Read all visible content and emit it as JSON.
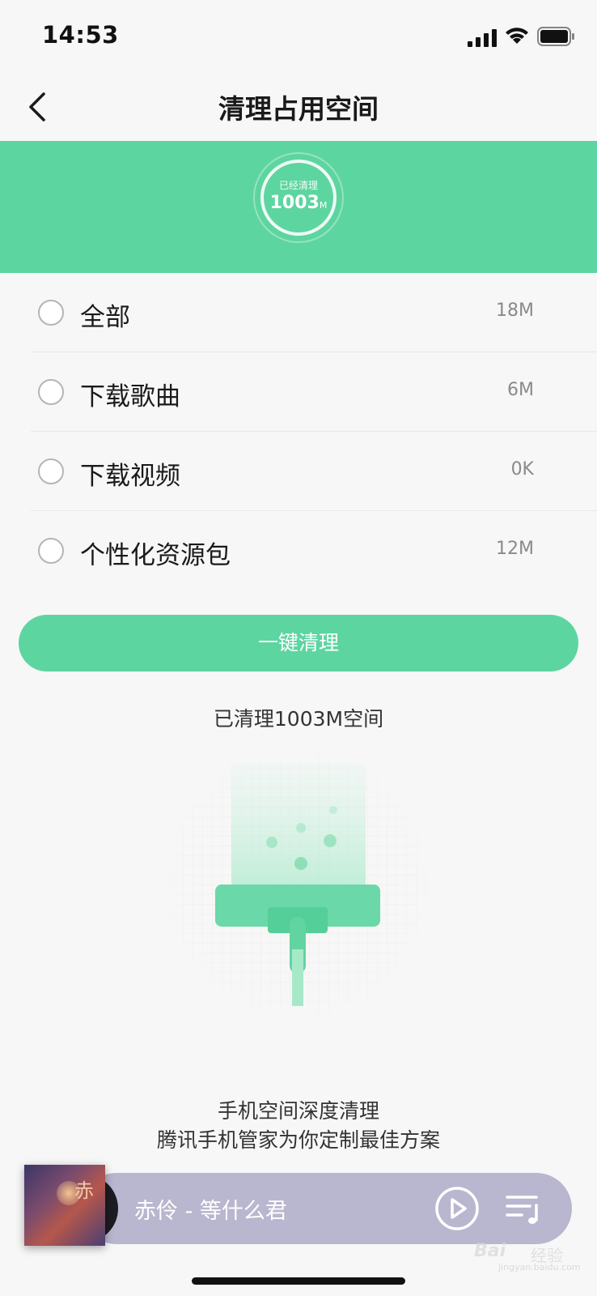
{
  "status_bar": {
    "time": "14:53"
  },
  "nav": {
    "title": "清理占用空间"
  },
  "banner": {
    "label": "已经清理",
    "value": "1003",
    "unit": "M",
    "accent_color": "#5dd5a0"
  },
  "items": [
    {
      "label": "全部",
      "size": "18M",
      "checked": false
    },
    {
      "label": "下载歌曲",
      "size": "6M",
      "checked": false
    },
    {
      "label": "下载视频",
      "size": "0K",
      "checked": false
    },
    {
      "label": "个性化资源包",
      "size": "12M",
      "checked": false
    }
  ],
  "clean_button": {
    "label": "一键清理"
  },
  "cleaned_summary": "已清理1003M空间",
  "footer": {
    "line1": "手机空间深度清理",
    "line2": "腾讯手机管家为你定制最佳方案"
  },
  "player": {
    "album_char": "赤",
    "song": "赤伶 - 等什么君",
    "icons": [
      "play-icon",
      "playlist-icon"
    ]
  },
  "watermark": {
    "brand": "Bai",
    "suffix": "经验",
    "url": "jingyan.baidu.com"
  }
}
